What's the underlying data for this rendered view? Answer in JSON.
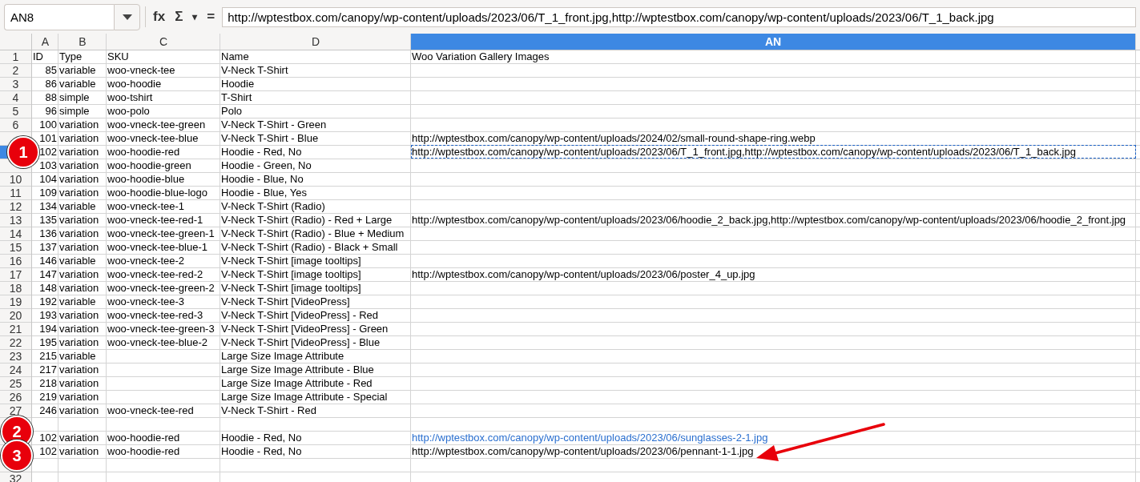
{
  "name_box": {
    "value": "AN8"
  },
  "toolbar_buttons": [
    "fx",
    "Σ",
    "▾",
    "="
  ],
  "formula_bar": {
    "value": "http://wptestbox.com/canopy/wp-content/uploads/2023/06/T_1_front.jpg,http://wptestbox.com/canopy/wp-content/uploads/2023/06/T_1_back.jpg"
  },
  "columns": [
    {
      "label": "A",
      "selected": false
    },
    {
      "label": "B",
      "selected": false
    },
    {
      "label": "C",
      "selected": false
    },
    {
      "label": "D",
      "selected": false
    },
    {
      "label": "AN",
      "selected": true
    }
  ],
  "rows": [
    {
      "header": "1",
      "cells": [
        "ID",
        "Type",
        "SKU",
        "Name",
        {
          "text": "Woo Variation Gallery Images",
          "link": false,
          "selected": false
        }
      ]
    },
    {
      "header": "2",
      "cells": [
        "85",
        "variable",
        "woo-vneck-tee",
        "V-Neck T-Shirt",
        null
      ]
    },
    {
      "header": "3",
      "cells": [
        "86",
        "variable",
        "woo-hoodie",
        "Hoodie",
        null
      ]
    },
    {
      "header": "4",
      "cells": [
        "88",
        "simple",
        "woo-tshirt",
        "T-Shirt",
        null
      ]
    },
    {
      "header": "5",
      "cells": [
        "96",
        "simple",
        "woo-polo",
        "Polo",
        null
      ]
    },
    {
      "header": "6",
      "cells": [
        "100",
        "variation",
        "woo-vneck-tee-green",
        "V-Neck T-Shirt - Green",
        null
      ]
    },
    {
      "cells": [
        "101",
        "variation",
        "woo-vneck-tee-blue",
        "V-Neck T-Shirt - Blue",
        {
          "text": "http://wptestbox.com/canopy/wp-content/uploads/2024/02/small-round-shape-ring.webp",
          "link": false,
          "selected": false
        }
      ]
    },
    {
      "cells": [
        "102",
        "variation",
        "woo-hoodie-red",
        "Hoodie - Red, No",
        {
          "text": "http://wptestbox.com/canopy/wp-content/uploads/2023/06/T_1_front.jpg,http://wptestbox.com/canopy/wp-content/uploads/2023/06/T_1_back.jpg",
          "link": false,
          "selected": true
        }
      ]
    },
    {
      "cells": [
        "103",
        "variation",
        "woo-hoodie-green",
        "Hoodie - Green, No",
        null
      ]
    },
    {
      "header": "10",
      "cells": [
        "104",
        "variation",
        "woo-hoodie-blue",
        "Hoodie - Blue, No",
        null
      ]
    },
    {
      "header": "11",
      "cells": [
        "109",
        "variation",
        "woo-hoodie-blue-logo",
        "Hoodie - Blue, Yes",
        null
      ]
    },
    {
      "header": "12",
      "cells": [
        "134",
        "variable",
        "woo-vneck-tee-1",
        "V-Neck T-Shirt (Radio)",
        null
      ]
    },
    {
      "header": "13",
      "cells": [
        "135",
        "variation",
        "woo-vneck-tee-red-1",
        "V-Neck T-Shirt (Radio) - Red + Large",
        {
          "text": "http://wptestbox.com/canopy/wp-content/uploads/2023/06/hoodie_2_back.jpg,http://wptestbox.com/canopy/wp-content/uploads/2023/06/hoodie_2_front.jpg",
          "link": false,
          "selected": false
        }
      ]
    },
    {
      "header": "14",
      "cells": [
        "136",
        "variation",
        "woo-vneck-tee-green-1",
        "V-Neck T-Shirt (Radio) - Blue + Medium",
        null
      ]
    },
    {
      "header": "15",
      "cells": [
        "137",
        "variation",
        "woo-vneck-tee-blue-1",
        "V-Neck T-Shirt (Radio) - Black + Small",
        null
      ]
    },
    {
      "header": "16",
      "cells": [
        "146",
        "variable",
        "woo-vneck-tee-2",
        "V-Neck T-Shirt [image tooltips]",
        null
      ]
    },
    {
      "header": "17",
      "cells": [
        "147",
        "variation",
        "woo-vneck-tee-red-2",
        "V-Neck T-Shirt [image tooltips]",
        {
          "text": "http://wptestbox.com/canopy/wp-content/uploads/2023/06/poster_4_up.jpg",
          "link": false,
          "selected": false
        }
      ]
    },
    {
      "header": "18",
      "cells": [
        "148",
        "variation",
        "woo-vneck-tee-green-2",
        "V-Neck T-Shirt [image tooltips]",
        null
      ]
    },
    {
      "header": "19",
      "cells": [
        "192",
        "variable",
        "woo-vneck-tee-3",
        "V-Neck T-Shirt [VideoPress]",
        null
      ]
    },
    {
      "header": "20",
      "cells": [
        "193",
        "variation",
        "woo-vneck-tee-red-3",
        "V-Neck T-Shirt [VideoPress] - Red",
        null
      ]
    },
    {
      "header": "21",
      "cells": [
        "194",
        "variation",
        "woo-vneck-tee-green-3",
        "V-Neck T-Shirt [VideoPress] - Green",
        null
      ]
    },
    {
      "header": "22",
      "cells": [
        "195",
        "variation",
        "woo-vneck-tee-blue-2",
        "V-Neck T-Shirt [VideoPress] - Blue",
        null
      ]
    },
    {
      "header": "23",
      "cells": [
        "215",
        "variable",
        null,
        "Large Size Image Attribute",
        null
      ]
    },
    {
      "header": "24",
      "cells": [
        "217",
        "variation",
        null,
        "Large Size Image Attribute - Blue",
        null
      ]
    },
    {
      "header": "25",
      "cells": [
        "218",
        "variation",
        null,
        "Large Size Image Attribute - Red",
        null
      ]
    },
    {
      "header": "26",
      "cells": [
        "219",
        "variation",
        null,
        "Large Size Image Attribute - Special",
        null
      ]
    },
    {
      "header": "27",
      "cells": [
        "246",
        "variation",
        "woo-vneck-tee-red",
        "V-Neck T-Shirt - Red",
        null
      ]
    },
    {
      "cells": [
        null,
        null,
        null,
        null,
        null
      ]
    },
    {
      "cells": [
        "102",
        "variation",
        "woo-hoodie-red",
        "Hoodie - Red, No",
        {
          "text": "http://wptestbox.com/canopy/wp-content/uploads/2023/06/sunglasses-2-1.jpg",
          "link": true,
          "selected": false
        }
      ]
    },
    {
      "cells": [
        "102",
        "variation",
        "woo-hoodie-red",
        "Hoodie - Red, No",
        {
          "text": "http://wptestbox.com/canopy/wp-content/uploads/2023/06/pennant-1-1.jpg",
          "link": false,
          "selected": false
        }
      ]
    },
    {
      "cells": [
        null,
        null,
        null,
        null,
        null
      ]
    },
    {
      "header": "32",
      "cells": [
        null,
        null,
        null,
        null,
        null
      ]
    }
  ],
  "markers": [
    {
      "label": "1"
    },
    {
      "label": "2"
    },
    {
      "label": "3"
    }
  ]
}
